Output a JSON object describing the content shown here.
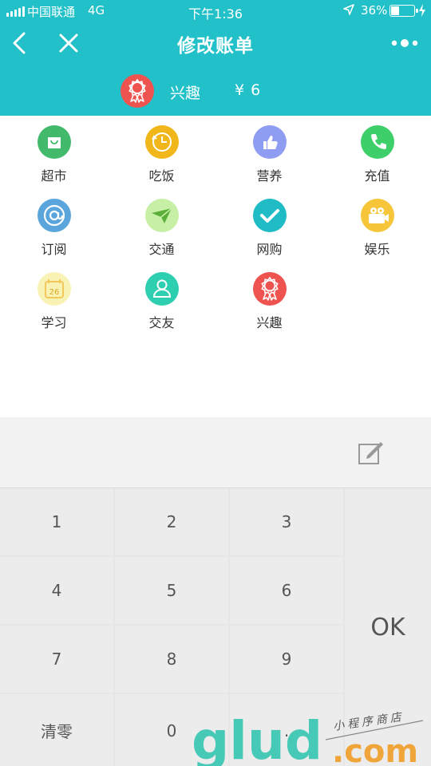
{
  "status": {
    "carrier": "中国联通",
    "network": "4G",
    "time": "下午1:36",
    "battery": "36%",
    "battery_level": 0.36
  },
  "nav": {
    "title": "修改账单",
    "back_icon": "chevron-left-icon",
    "close_icon": "close-icon",
    "more_icon": "more-dots-icon"
  },
  "selected": {
    "name": "兴趣",
    "amount": "¥  6",
    "icon": "ribbon-award-icon",
    "color": "#ef5350"
  },
  "categories": [
    {
      "label": "超市",
      "icon": "shopping-bag-icon",
      "color": "#43b96c"
    },
    {
      "label": "吃饭",
      "icon": "clock-icon",
      "color": "#f1b71a"
    },
    {
      "label": "营养",
      "icon": "thumbs-up-icon",
      "color": "#8e9cf2"
    },
    {
      "label": "充值",
      "icon": "phone-icon",
      "color": "#3fcf6a"
    },
    {
      "label": "订阅",
      "icon": "at-sign-icon",
      "color": "#5aa6dc"
    },
    {
      "label": "交通",
      "icon": "paper-plane-icon",
      "color": "#c8efa6"
    },
    {
      "label": "网购",
      "icon": "checkmark-icon",
      "color": "#1fbcc6"
    },
    {
      "label": "娱乐",
      "icon": "camera-icon",
      "color": "#f6c53a"
    },
    {
      "label": "学习",
      "icon": "calendar-icon",
      "color": "#f8f3b5"
    },
    {
      "label": "交友",
      "icon": "user-icon",
      "color": "#2ecfb0"
    },
    {
      "label": "兴趣",
      "icon": "ribbon-award-icon",
      "color": "#ef5350"
    }
  ],
  "note": {
    "icon": "edit-note-icon"
  },
  "keypad": {
    "keys": [
      "1",
      "2",
      "3",
      "4",
      "5",
      "6",
      "7",
      "8",
      "9",
      "清零",
      "0",
      "."
    ],
    "ok": "OK"
  },
  "watermark": {
    "text": "glud",
    "domain": ".com",
    "tagline": "小程序商店"
  }
}
